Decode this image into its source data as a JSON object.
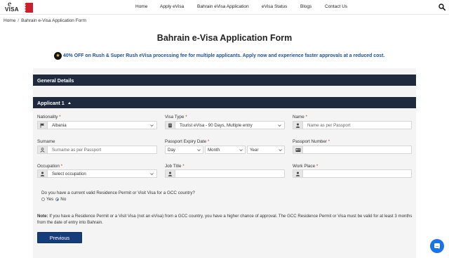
{
  "header": {
    "logo_letter": "e",
    "logo_word": "VISA",
    "nav": [
      "Home",
      "Apply eVisa",
      "Bahrain eVisa Application",
      "eVisa Status",
      "Blogs",
      "Contact Us"
    ]
  },
  "breadcrumb": {
    "home": "Home",
    "separator": "/",
    "current": "Bahrain e-Visa Application Form"
  },
  "page_title": "Bahrain e-Visa Application Form",
  "promo": "40% OFF on Rush & Super Rush eVisa processing fee for multiple applicants. Apply now and experience faster approvals at a reduced cost.",
  "sections": {
    "general": "General Details",
    "applicant": "Applicant 1"
  },
  "form": {
    "required_mark": "*",
    "nationality": {
      "label": "Nationality",
      "value": "Albania",
      "icon": "flag-icon"
    },
    "visa_type": {
      "label": "Visa Type",
      "value": "Tourist eVisa - 90 Days, Multiple entry",
      "icon": "passport-icon"
    },
    "name": {
      "label": "Name",
      "placeholder": "Name as per Passport",
      "icon": "person-icon"
    },
    "surname": {
      "label": "Surname",
      "placeholder": "Surname as per Passport",
      "icon": "person-outline-icon"
    },
    "passport_expiry": {
      "label": "Passport Expiry Date",
      "day": "Day",
      "month": "Month",
      "year": "Year"
    },
    "passport_number": {
      "label": "Passport Number",
      "value": "",
      "icon": "id-card-icon"
    },
    "occupation": {
      "label": "Occupation",
      "value": "Select occupation",
      "icon": "person-icon"
    },
    "job_title": {
      "label": "Job Title",
      "value": "",
      "icon": "person-icon"
    },
    "work_place": {
      "label": "Work Place",
      "value": "",
      "icon": "person-icon"
    }
  },
  "gcc": {
    "question": "Do you have a current valid Residence Permit or Visit Visa for a GCC country?",
    "yes": "Yes",
    "no": "No",
    "selected": "No"
  },
  "note": {
    "label": "Note:",
    "text": " If you have a Residence Permit or a Visit Visa (not an eVisa) from a GCC country, you have a higher chance of approval. The GCC Residence Permit or Visa must be valid for at least 3 months from the date of entry into Bahrain."
  },
  "buttons": {
    "previous": "Previous"
  },
  "colors": {
    "section_bar": "#1f2b3d",
    "promo_text": "#1e4f9c",
    "primary_button": "#153d7a",
    "chat_button": "#1a73e8",
    "required": "#d32f2f"
  }
}
